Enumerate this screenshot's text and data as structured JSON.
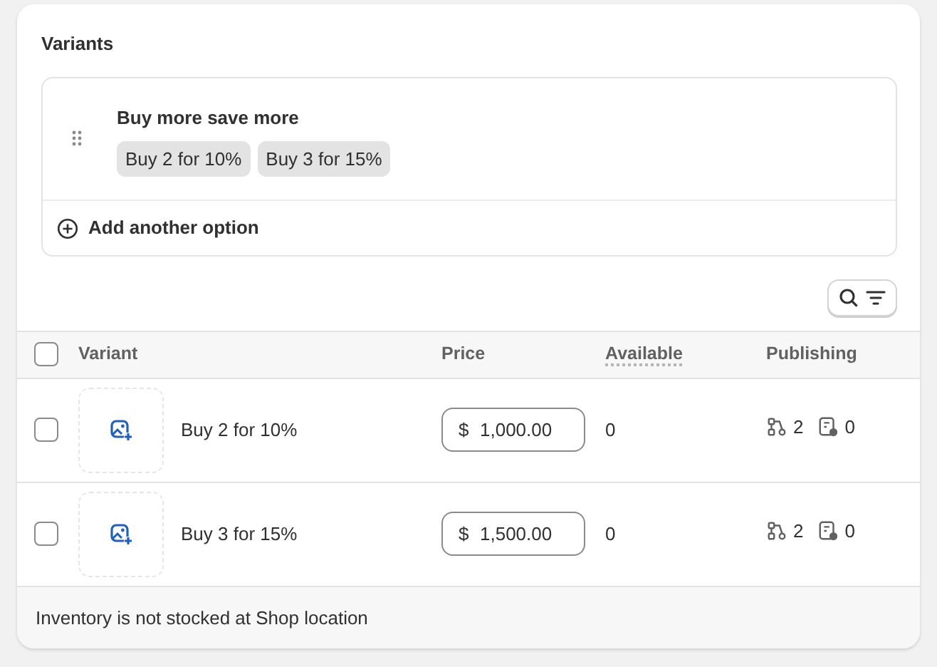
{
  "card": {
    "title": "Variants"
  },
  "option": {
    "name": "Buy more save more",
    "values": [
      "Buy 2 for 10%",
      "Buy 3 for 15%"
    ],
    "add_label": "Add another option"
  },
  "table": {
    "columns": [
      "Variant",
      "Price",
      "Available",
      "Publishing"
    ],
    "select_all_checked": false,
    "rows": [
      {
        "name": "Buy 2 for 10%",
        "currency": "$",
        "price": "1,000.00",
        "available": "0",
        "channels": "2",
        "catalogs": "0",
        "checked": false
      },
      {
        "name": "Buy 3 for 15%",
        "currency": "$",
        "price": "1,500.00",
        "available": "0",
        "channels": "2",
        "catalogs": "0",
        "checked": false
      }
    ]
  },
  "footer": "Inventory is not stocked at Shop location"
}
